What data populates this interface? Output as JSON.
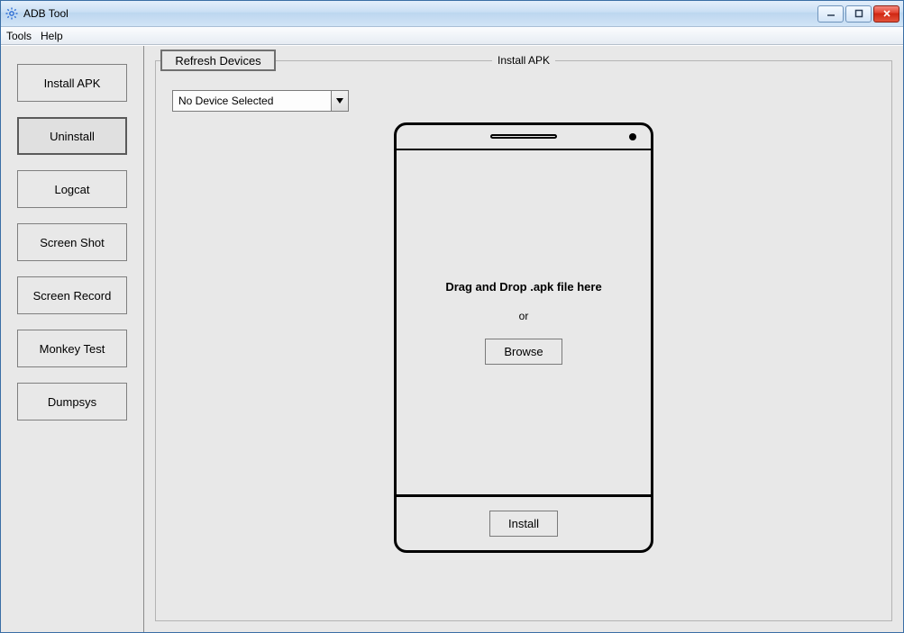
{
  "window": {
    "title": "ADB Tool"
  },
  "menu": {
    "tools": "Tools",
    "help": "Help"
  },
  "sidebar": {
    "install_apk": "Install APK",
    "uninstall": "Uninstall",
    "logcat": "Logcat",
    "screenshot": "Screen Shot",
    "screenrecord": "Screen Record",
    "monkeytest": "Monkey Test",
    "dumpsys": "Dumpsys"
  },
  "content": {
    "refresh": "Refresh Devices",
    "panel_title": "Install APK",
    "device_selected": "No Device Selected",
    "drop_text": "Drag and Drop .apk file here",
    "or_text": "or",
    "browse": "Browse",
    "install": "Install"
  }
}
